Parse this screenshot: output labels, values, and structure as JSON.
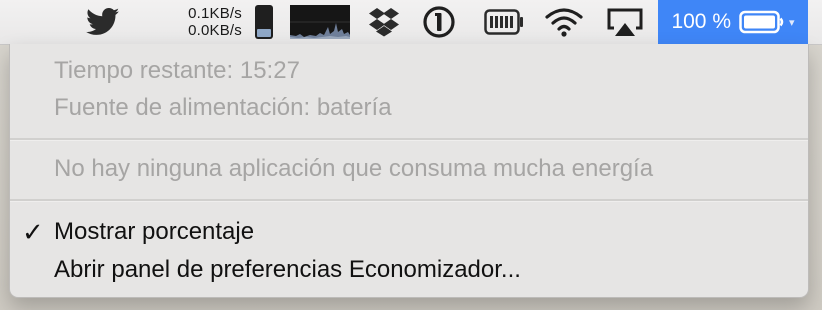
{
  "menubar": {
    "network": {
      "upload": "0.1KB/s",
      "download": "0.0KB/s"
    },
    "icons": [
      "twitter-icon",
      "memory-gauge-icon",
      "activity-graph-icon",
      "dropbox-icon",
      "1password-icon",
      "battery-cells-icon",
      "wifi-icon",
      "airplay-icon"
    ],
    "battery": {
      "percent_label": "100 %",
      "level": 1.0
    },
    "accent_color": "#3f86f7"
  },
  "battery_menu": {
    "time_remaining": "Tiempo restante: 15:27",
    "power_source": "Fuente de alimentación: batería",
    "energy_status": "No hay ninguna aplicación que consuma mucha energía",
    "show_percentage": {
      "label": "Mostrar porcentaje",
      "checked": true,
      "check_glyph": "✓"
    },
    "open_preferences": "Abrir panel de preferencias Economizador..."
  }
}
